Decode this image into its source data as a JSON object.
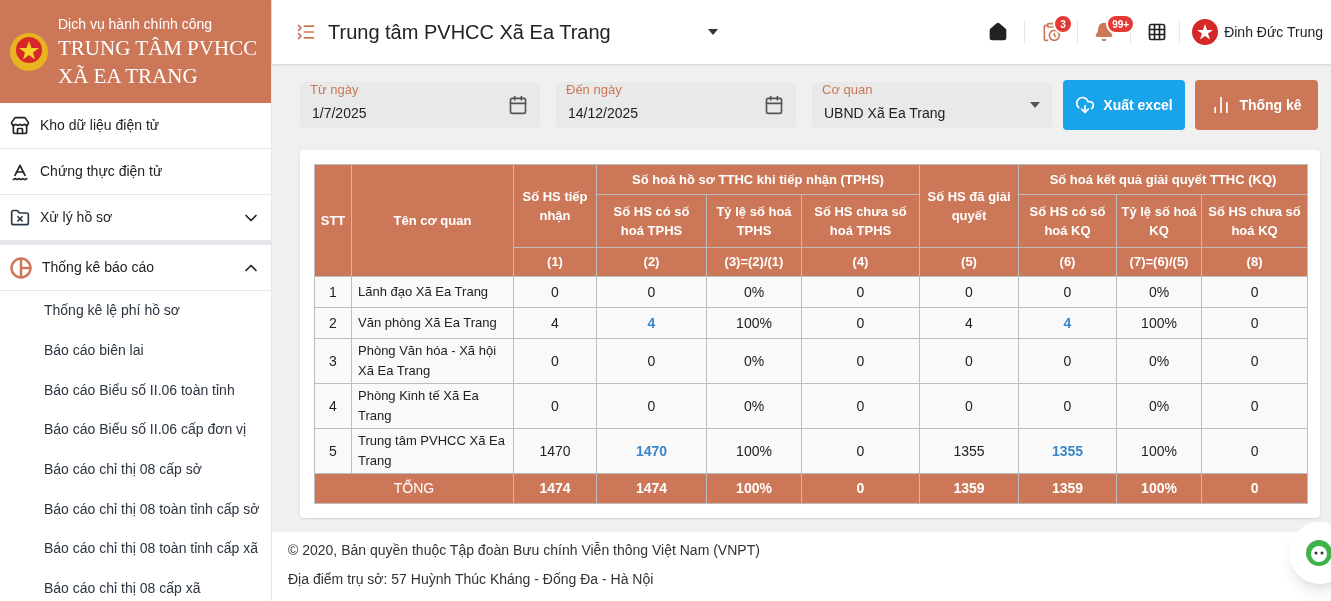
{
  "sidebar": {
    "brand": {
      "subtitle": "Dịch vụ hành chính công",
      "title_lines": [
        "TRUNG TÂM PVHCC",
        "XÃ EA TRANG"
      ]
    },
    "items": [
      {
        "kind": "store",
        "label": "Kho dữ liệu điện tử"
      },
      {
        "kind": "spell",
        "label": "Chứng thực điện tử"
      },
      {
        "kind": "folder",
        "label": "Xử lý hồ sơ",
        "expanded": false
      },
      {
        "kind": "chart",
        "label": "Thống kê báo cáo",
        "expanded": true,
        "children": [
          {
            "label": "Thống kê lệ phí hồ sơ"
          },
          {
            "label": "Báo cáo biên lai"
          },
          {
            "label": "Báo cáo Biểu số II.06 toàn tỉnh"
          },
          {
            "label": "Báo cáo Biểu số II.06 cấp đơn vị"
          },
          {
            "label": "Báo cáo chỉ thị 08 cấp sở"
          },
          {
            "label": "Báo cáo chỉ thị 08 toàn tỉnh cấp sở"
          },
          {
            "label": "Báo cáo chỉ thị 08 toàn tỉnh cấp xã"
          },
          {
            "label": "Báo cáo chỉ thị 08 cấp xã"
          }
        ]
      }
    ]
  },
  "header": {
    "title": "Trung tâm PVHCC Xã Ea Trang",
    "task_badge": "3",
    "notification_badge": "99+",
    "user_name": "Đinh Đức Trung"
  },
  "filters": {
    "from_date": {
      "label": "Từ ngày",
      "value": "1/7/2025"
    },
    "to_date": {
      "label": "Đến ngày",
      "value": "14/12/2025"
    },
    "agency": {
      "label": "Cơ quan",
      "value": "UBND Xã Ea Trang"
    },
    "export_button": "Xuất excel",
    "stats_button": "Thống kê"
  },
  "table": {
    "col_stt": "STT",
    "col_name": "Tên cơ quan",
    "col_received": "Số HS tiếp nhận",
    "group_tphs": "Số hoá hồ sơ TTHC khi tiếp nhận (TPHS)",
    "tphs_columns": [
      "Số HS có số hoá TPHS",
      "Tỷ lệ số hoá TPHS",
      "Số HS chưa số hoá TPHS"
    ],
    "col_resolved": "Số HS đã giải quyết",
    "group_kq": "Số hoá kết quả giải quyết TTHC (KQ)",
    "kq_columns": [
      "Số HS có số hoá KQ",
      "Tỷ lệ số hoá KQ",
      "Số HS chưa số hoá KQ"
    ],
    "formula_row": [
      "(1)",
      "(2)",
      "(3)=(2)/(1)",
      "(4)",
      "(5)",
      "(6)",
      "(7)=(6)/(5)",
      "(8)"
    ],
    "rows": [
      {
        "stt": "1",
        "name": "Lãnh đạo Xã Ea Trang",
        "values": [
          {
            "text": "0",
            "link": false
          },
          {
            "text": "0",
            "link": false
          },
          {
            "text": "0%",
            "link": false
          },
          {
            "text": "0",
            "link": false
          },
          {
            "text": "0",
            "link": false
          },
          {
            "text": "0",
            "link": false
          },
          {
            "text": "0%",
            "link": false
          },
          {
            "text": "0",
            "link": false
          }
        ]
      },
      {
        "stt": "2",
        "name": "Văn phòng Xã Ea Trang",
        "values": [
          {
            "text": "4",
            "link": false
          },
          {
            "text": "4",
            "link": true
          },
          {
            "text": "100%",
            "link": false
          },
          {
            "text": "0",
            "link": false
          },
          {
            "text": "4",
            "link": false
          },
          {
            "text": "4",
            "link": true
          },
          {
            "text": "100%",
            "link": false
          },
          {
            "text": "0",
            "link": false
          }
        ]
      },
      {
        "stt": "3",
        "name": "Phòng Văn hóa - Xã hội Xã Ea Trang",
        "values": [
          {
            "text": "0",
            "link": false
          },
          {
            "text": "0",
            "link": false
          },
          {
            "text": "0%",
            "link": false
          },
          {
            "text": "0",
            "link": false
          },
          {
            "text": "0",
            "link": false
          },
          {
            "text": "0",
            "link": false
          },
          {
            "text": "0%",
            "link": false
          },
          {
            "text": "0",
            "link": false
          }
        ]
      },
      {
        "stt": "4",
        "name": "Phòng Kinh tế Xã Ea Trang",
        "values": [
          {
            "text": "0",
            "link": false
          },
          {
            "text": "0",
            "link": false
          },
          {
            "text": "0%",
            "link": false
          },
          {
            "text": "0",
            "link": false
          },
          {
            "text": "0",
            "link": false
          },
          {
            "text": "0",
            "link": false
          },
          {
            "text": "0%",
            "link": false
          },
          {
            "text": "0",
            "link": false
          }
        ]
      },
      {
        "stt": "5",
        "name": "Trung tâm PVHCC Xã Ea Trang",
        "values": [
          {
            "text": "1470",
            "link": false
          },
          {
            "text": "1470",
            "link": true
          },
          {
            "text": "100%",
            "link": false
          },
          {
            "text": "0",
            "link": false
          },
          {
            "text": "1355",
            "link": false
          },
          {
            "text": "1355",
            "link": true
          },
          {
            "text": "100%",
            "link": false
          },
          {
            "text": "0",
            "link": false
          }
        ]
      }
    ],
    "total": {
      "label": "TỔNG",
      "values": [
        "1474",
        "1474",
        "100%",
        "0",
        "1359",
        "1359",
        "100%",
        "0"
      ]
    }
  },
  "footer": {
    "copyright": "© 2020, Bản quyền thuộc Tập đoàn Bưu chính Viễn thông Việt Nam (VNPT)",
    "address": "Địa điểm trụ sở: 57 Huỳnh Thúc Kháng - Đống Đa - Hà Nội"
  }
}
